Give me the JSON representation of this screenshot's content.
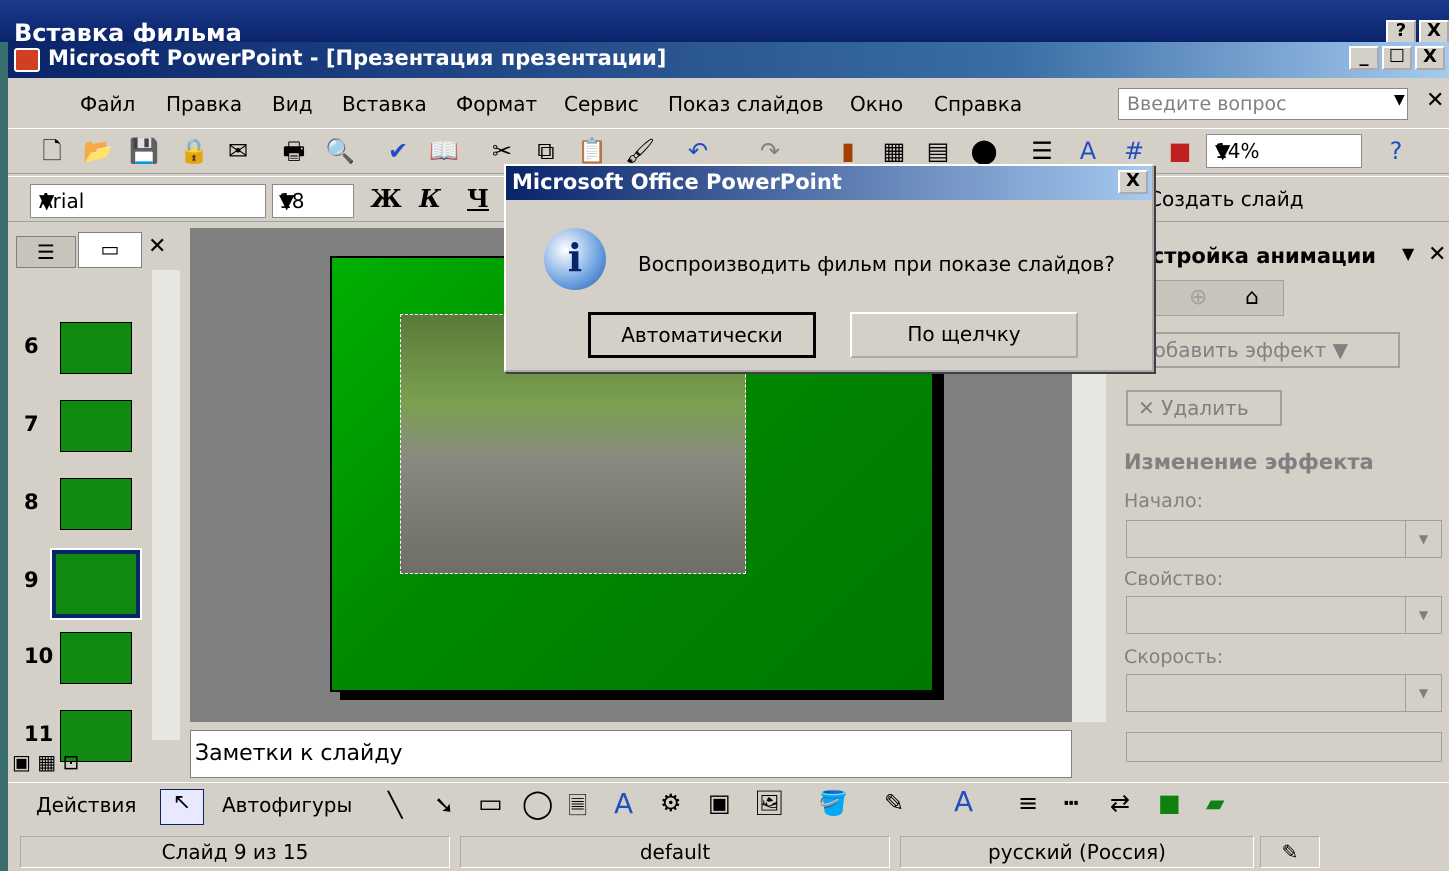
{
  "outer_window": {
    "title": "Вставка фильма",
    "help": "?",
    "close": "X"
  },
  "ppt_window": {
    "title": "Microsoft PowerPoint - [Презентация презентации]",
    "minimize": "_",
    "maximize": "☐",
    "close": "X"
  },
  "menu": {
    "items": [
      "Файл",
      "Правка",
      "Вид",
      "Вставка",
      "Формат",
      "Сервис",
      "Показ слайдов",
      "Окно",
      "Справка"
    ],
    "help_placeholder": "Введите вопрос"
  },
  "toolbar": {
    "zoom": "14%",
    "font": "Arial",
    "font_size": "18",
    "bold": "Ж",
    "italic": "К",
    "underline": "Ч",
    "new_slide": "Создать слайд"
  },
  "slides_pane": {
    "close": "✕",
    "slides": [
      {
        "num": "6"
      },
      {
        "num": "7"
      },
      {
        "num": "8"
      },
      {
        "num": "9"
      },
      {
        "num": "10"
      },
      {
        "num": "11"
      }
    ]
  },
  "notes": {
    "placeholder": "Заметки к слайду"
  },
  "task_pane": {
    "title": "Настройка анимации",
    "add_effect": "Добавить эффект",
    "delete": "Удалить",
    "section": "Изменение эффекта",
    "start_label": "Начало:",
    "property_label": "Свойство:",
    "speed_label": "Скорость:"
  },
  "draw_bar": {
    "actions": "Действия",
    "autoshapes": "Автофигуры"
  },
  "status": {
    "slide": "Слайд 9 из 15",
    "design": "default",
    "language": "русский (Россия)"
  },
  "dialog": {
    "title": "Microsoft Office PowerPoint",
    "message": "Воспроизводить фильм при показе слайдов?",
    "btn_auto": "Автоматически",
    "btn_click": "По щелчку",
    "close": "X"
  }
}
